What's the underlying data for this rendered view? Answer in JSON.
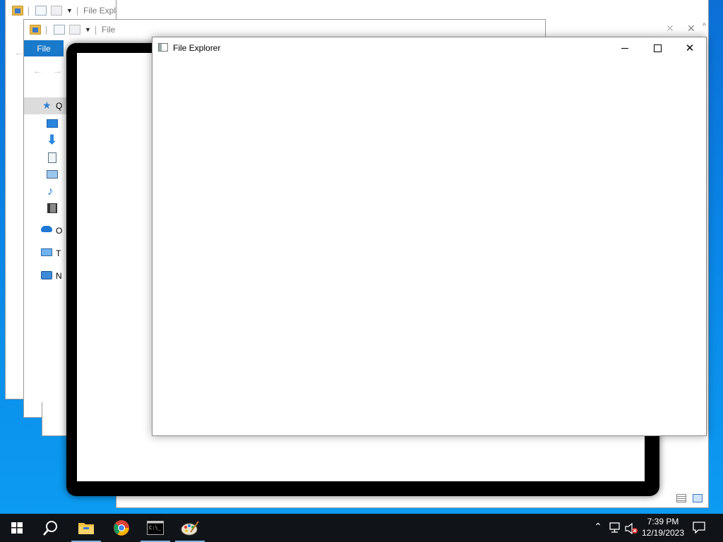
{
  "windows": {
    "back1": {
      "title": "File Explo"
    },
    "back2": {
      "title": "File",
      "menu_file": "File"
    },
    "front": {
      "title": "File Explorer",
      "controls": {
        "minimize": "─",
        "maximize": "☐",
        "close": "✕"
      }
    }
  },
  "sidebar": {
    "items": [
      {
        "icon": "star-icon",
        "label": "Q"
      },
      {
        "icon": "desktop-icon",
        "label": ""
      },
      {
        "icon": "download-icon",
        "label": ""
      },
      {
        "icon": "document-icon",
        "label": ""
      },
      {
        "icon": "pictures-icon",
        "label": ""
      },
      {
        "icon": "music-icon",
        "label": ""
      },
      {
        "icon": "video-icon",
        "label": ""
      },
      {
        "icon": "onedrive-icon",
        "label": "O"
      },
      {
        "icon": "this-pc-icon",
        "label": "T"
      },
      {
        "icon": "network-icon",
        "label": "N"
      }
    ]
  },
  "taskbar": {
    "apps": [
      {
        "name": "start",
        "icon": "windows-logo-icon"
      },
      {
        "name": "search",
        "icon": "search-icon"
      },
      {
        "name": "file-explorer",
        "icon": "folder-icon"
      },
      {
        "name": "chrome",
        "icon": "chrome-icon"
      },
      {
        "name": "terminal",
        "icon": "terminal-icon"
      },
      {
        "name": "paint",
        "icon": "paint-icon"
      }
    ],
    "clock": {
      "time": "7:39 PM",
      "date": "12/19/2023"
    }
  },
  "colors": {
    "accent": "#1979ca",
    "taskbar": "#101317",
    "desktop_top": "#0b6fd6",
    "desktop_bottom": "#0c9ef2"
  }
}
